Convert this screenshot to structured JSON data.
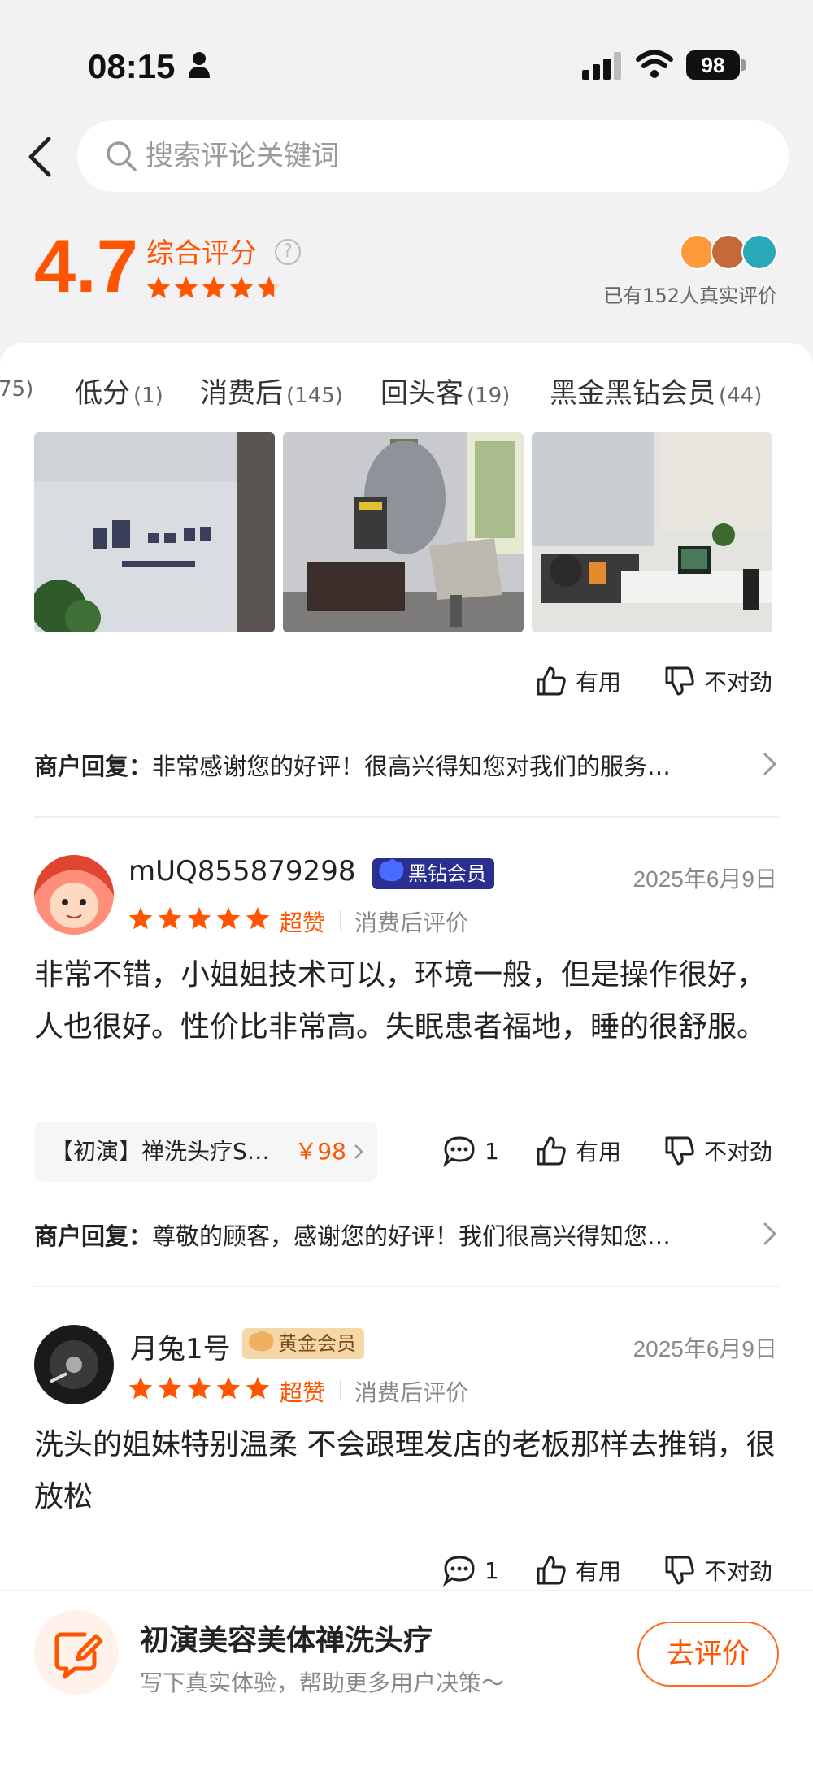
{
  "status_bar": {
    "time": "08:15",
    "battery": "98"
  },
  "search": {
    "placeholder": "搜索评论关键词"
  },
  "summary": {
    "score": "4.7",
    "label": "综合评分",
    "help": "?",
    "rating_stars": 4.7,
    "reviewers": "已有152人真实评价"
  },
  "tabs": [
    {
      "label": "",
      "count": "75)"
    },
    {
      "label": "低分",
      "count": "(1)"
    },
    {
      "label": "消费后",
      "count": "(145)"
    },
    {
      "label": "回头客",
      "count": "(19)"
    },
    {
      "label": "黑金黑钻会员",
      "count": "(44)"
    }
  ],
  "feedback": {
    "useful": "有用",
    "wrong": "不对劲"
  },
  "review0": {
    "reply_label": "商户回复：",
    "reply": "非常感谢您的好评！很高兴得知您对我们的服务…"
  },
  "review1": {
    "user": "mUQ855879298",
    "badge": "黑钻会员",
    "date": "2025年6月9日",
    "stars": 5,
    "praise": "超赞",
    "tag": "消费后评价",
    "text": "非常不错，小姐姐技术可以，环境一般，但是操作很好，人也很好。性价比非常高。失眠患者福地，睡的很舒服。",
    "product": "【初演】禅洗头疗S…",
    "price": "￥98",
    "comments": "1",
    "reply_label": "商户回复：",
    "reply": "尊敬的顾客，感谢您的好评！我们很高兴得知您…"
  },
  "review2": {
    "user": "月兔1号",
    "badge": "黄金会员",
    "date": "2025年6月9日",
    "stars": 5,
    "praise": "超赞",
    "tag": "消费后评价",
    "text": "洗头的姐妹特别温柔 不会跟理发店的老板那样去推销，很放松",
    "comments": "1"
  },
  "bottom_bar": {
    "shop_name": "初演美容美体禅洗头疗",
    "subtitle": "写下真实体验，帮助更多用户决策～",
    "button": "去评价"
  },
  "colors": {
    "accent": "#ff5500",
    "black_diamond": "#2a2f8f",
    "gold": "#f5d7a8"
  }
}
